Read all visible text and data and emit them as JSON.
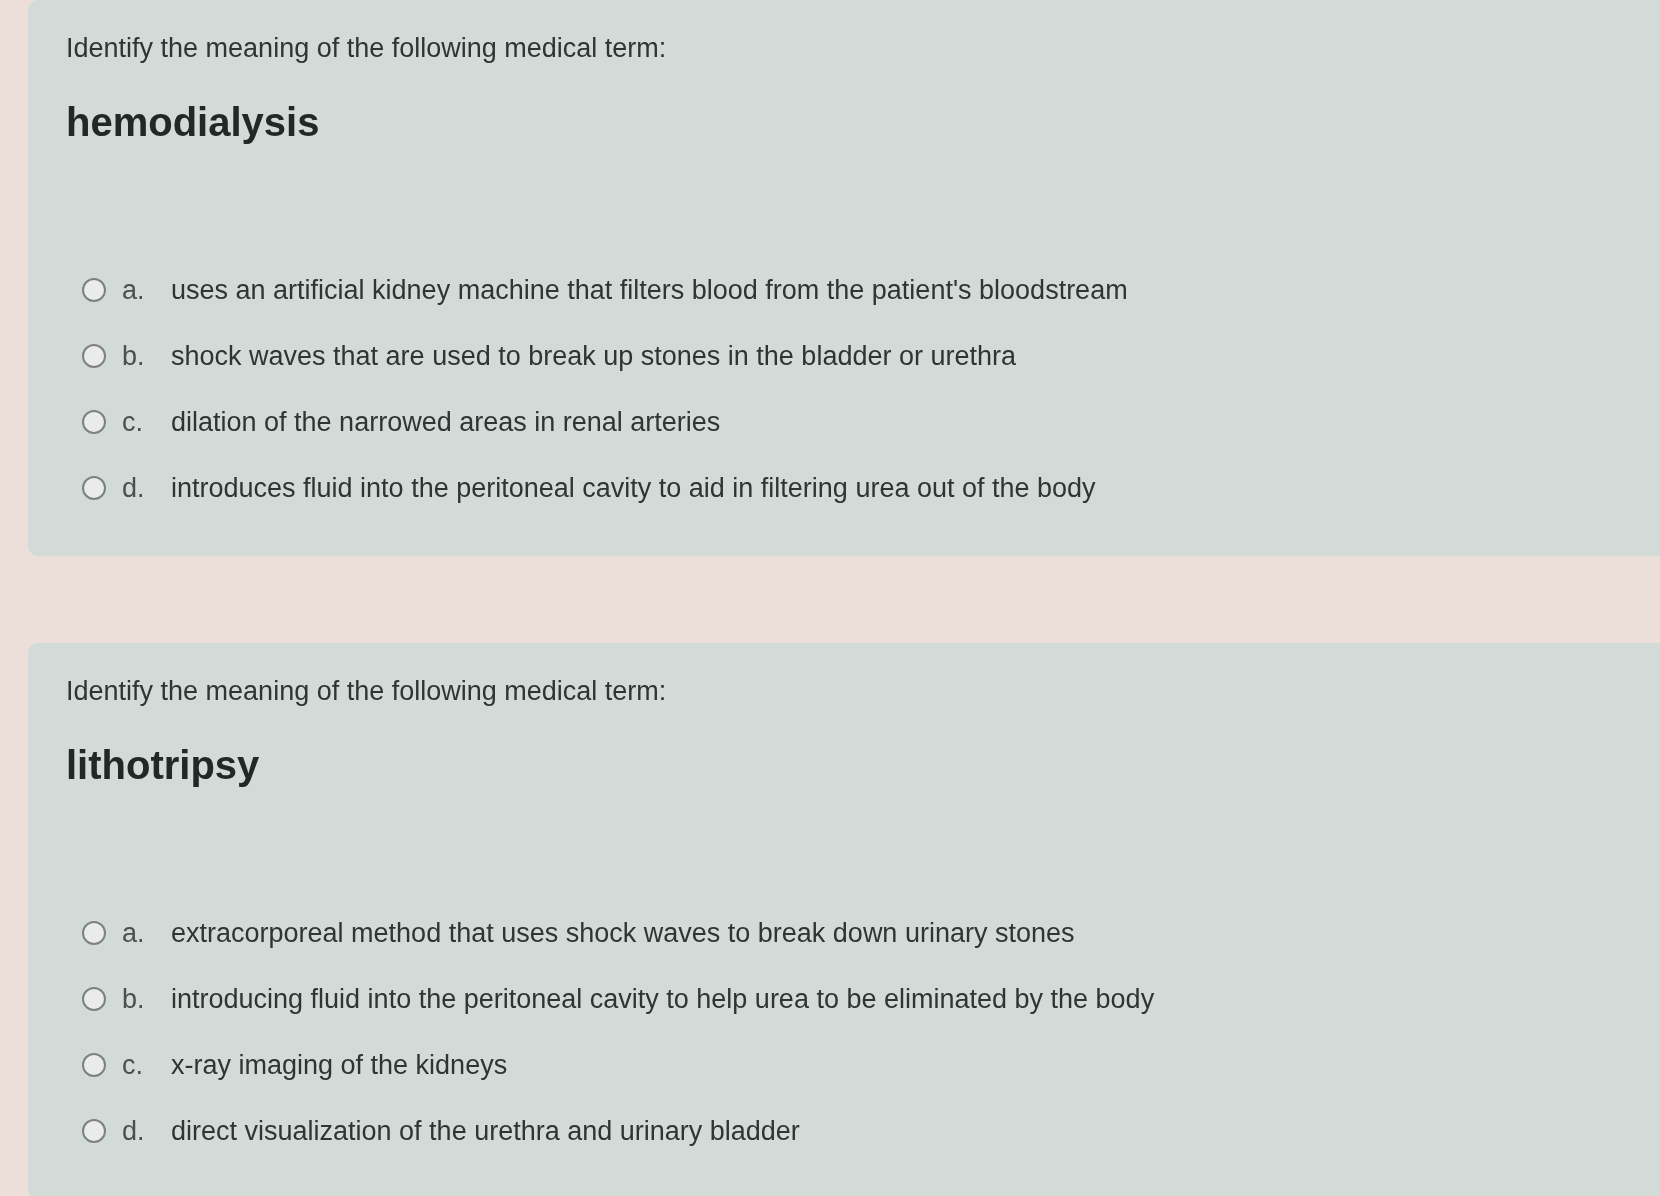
{
  "questions": [
    {
      "prompt": "Identify the meaning of the following medical term:",
      "term": "hemodialysis",
      "options": [
        {
          "letter": "a.",
          "text": "uses an artificial kidney machine that filters blood from the patient's bloodstream",
          "selected": false
        },
        {
          "letter": "b.",
          "text": "shock waves that are used to break up stones in the bladder or urethra",
          "selected": false
        },
        {
          "letter": "c.",
          "text": "dilation of the narrowed areas in renal arteries",
          "selected": false
        },
        {
          "letter": "d.",
          "text": "introduces fluid into the peritoneal cavity to aid in filtering urea out of the body",
          "selected": false
        }
      ]
    },
    {
      "prompt": "Identify the meaning of the following medical term:",
      "term": "lithotripsy",
      "options": [
        {
          "letter": "a.",
          "text": "extracorporeal method that uses shock waves to break down urinary stones",
          "selected": false
        },
        {
          "letter": "b.",
          "text": "introducing fluid into the peritoneal cavity to help urea to be eliminated by the body",
          "selected": false
        },
        {
          "letter": "c.",
          "text": "x-ray imaging of the kidneys",
          "selected": false
        },
        {
          "letter": "d.",
          "text": "direct visualization of the urethra and urinary bladder",
          "selected": false
        }
      ]
    }
  ]
}
